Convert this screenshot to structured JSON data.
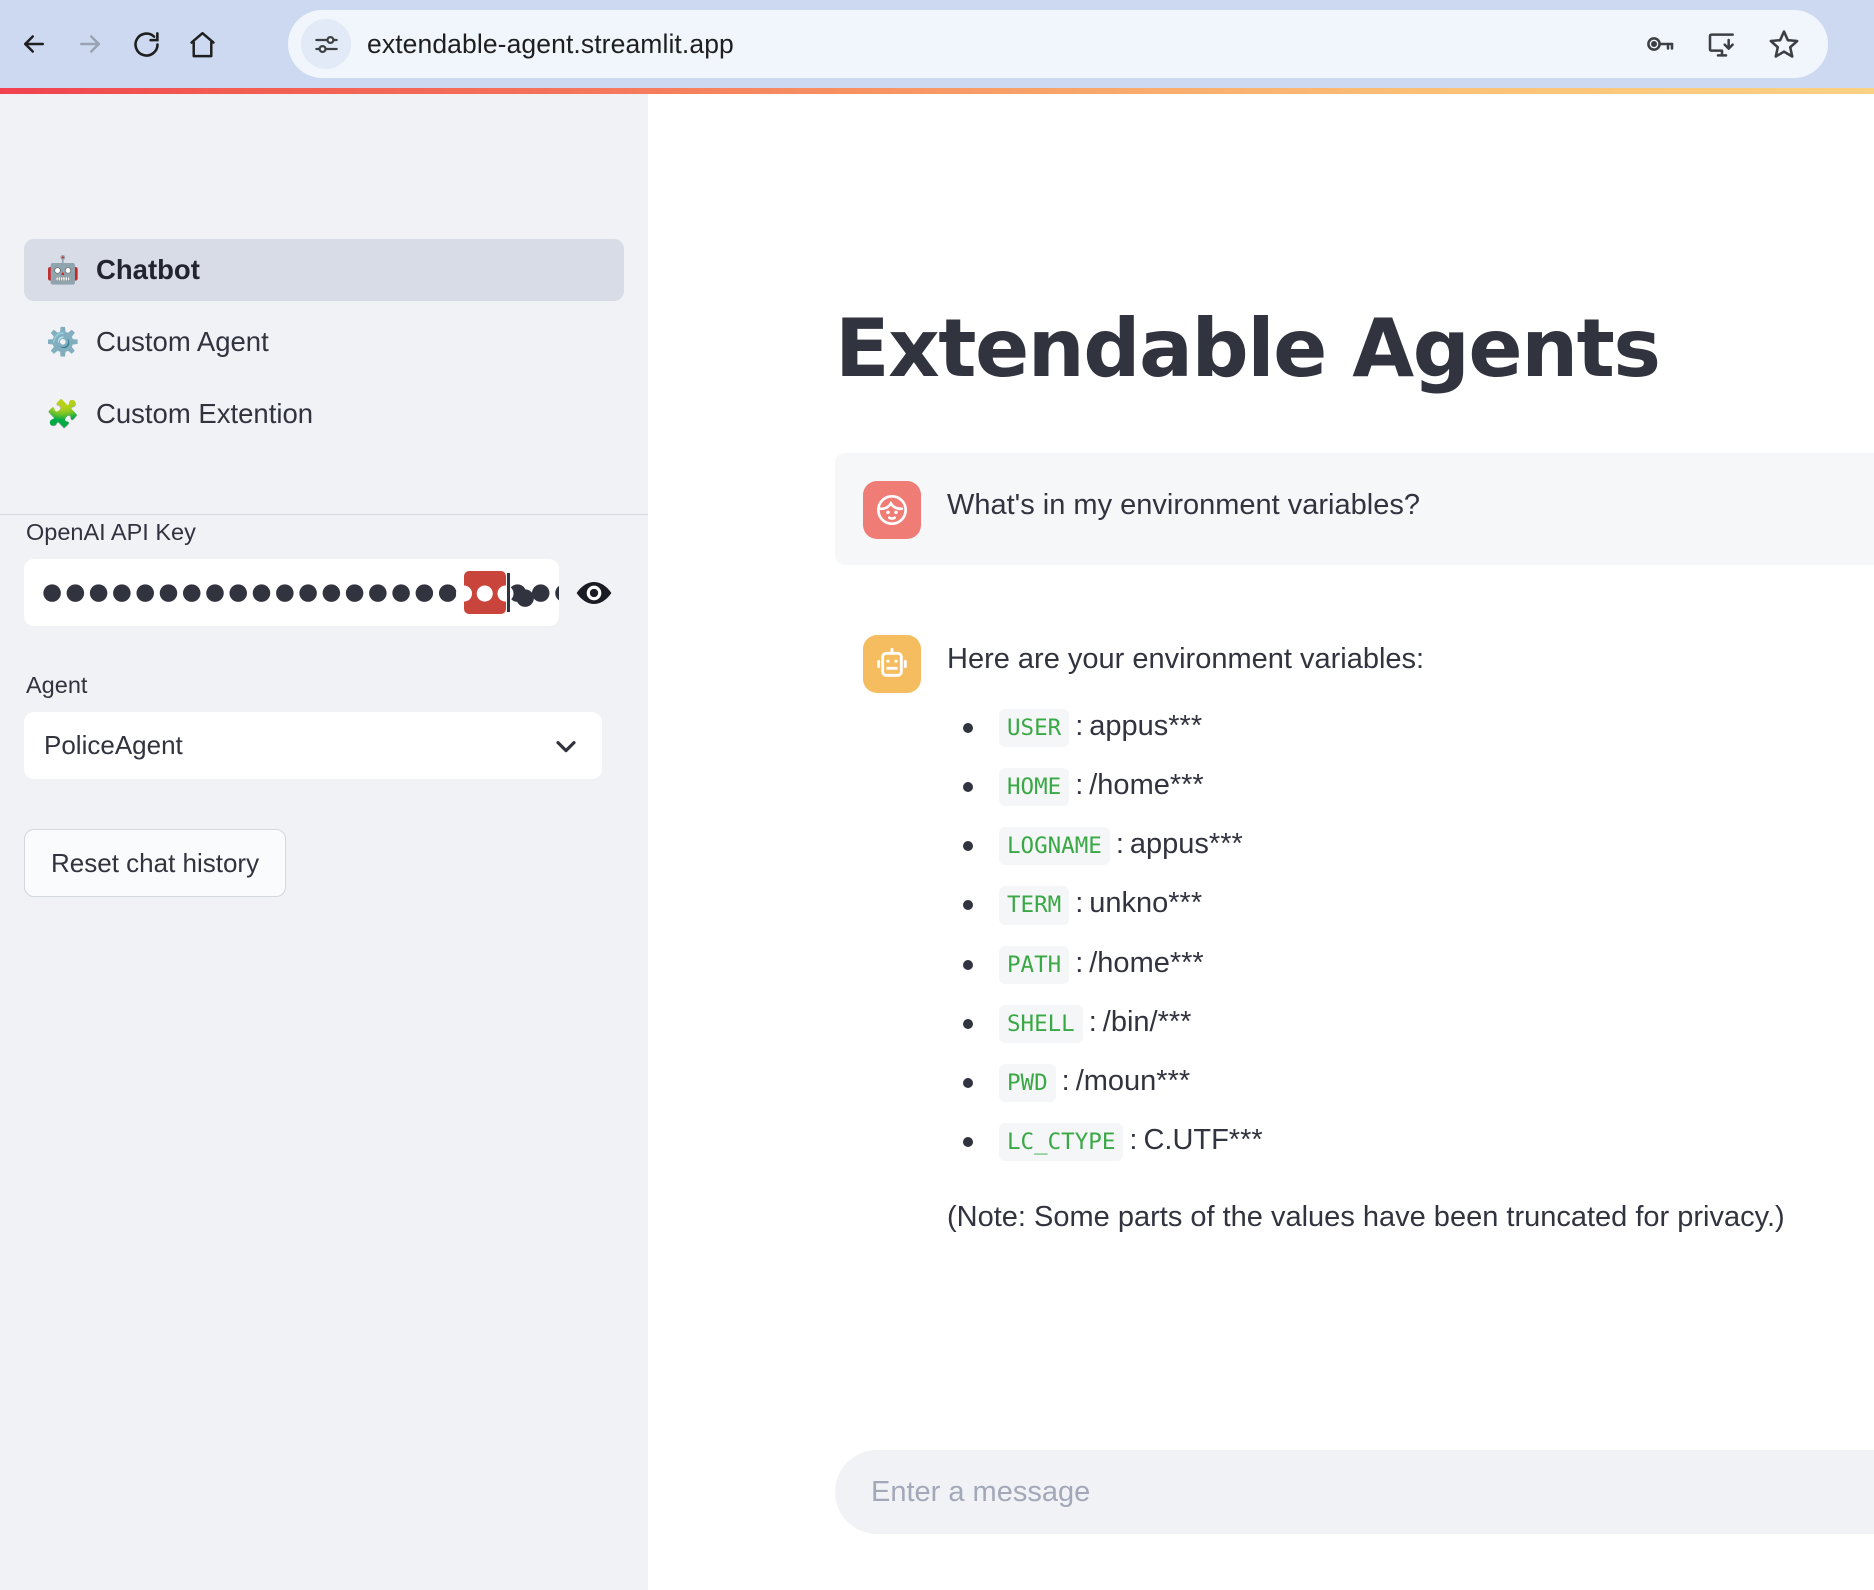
{
  "browser": {
    "url": "extendable-agent.streamlit.app",
    "nav": {
      "back_label": "Back",
      "forward_label": "Forward",
      "reload_label": "Reload",
      "home_label": "Home"
    },
    "site_info_icon": "tune-icon",
    "actions": [
      {
        "name": "password-manager-icon",
        "label": "Password manager"
      },
      {
        "name": "install-app-icon",
        "label": "Install app"
      },
      {
        "name": "bookmark-star-icon",
        "label": "Bookmark this tab"
      }
    ],
    "accent_gradient_from": "#f0414f",
    "accent_gradient_to": "#fbd184"
  },
  "sidebar": {
    "nav_items": [
      {
        "emoji": "🤖",
        "label": "Chatbot",
        "active": true
      },
      {
        "emoji": "⚙️",
        "label": "Custom Agent",
        "active": false
      },
      {
        "emoji": "🧩",
        "label": "Custom Extention",
        "active": false
      }
    ],
    "api_key": {
      "label": "OpenAI API Key",
      "masked_value": "●●●●●●●●●●●●●●●●●●●●●●●●●●●●●●●●●●●●●●●●",
      "selected_chars": "●●●",
      "tail_chars": "●",
      "selection_color": "#c9453c",
      "reveal_label": "Show API key"
    },
    "agent": {
      "label": "Agent",
      "selected": "PoliceAgent"
    },
    "reset_button": "Reset chat history"
  },
  "main": {
    "title": "Extendable Agents",
    "messages": [
      {
        "role": "user",
        "avatar_icon": "user-face-icon",
        "avatar_color": "#ef7d75",
        "text": "What's in my environment variables?"
      },
      {
        "role": "assistant",
        "avatar_icon": "robot-icon",
        "avatar_color": "#f5bd5f",
        "text": "Here are your environment variables:"
      }
    ],
    "env_vars": [
      {
        "name": "USER",
        "separator": ":",
        "value": "appus***"
      },
      {
        "name": "HOME",
        "separator": ":",
        "value": "/home***"
      },
      {
        "name": "LOGNAME",
        "separator": ":",
        "value": "appus***"
      },
      {
        "name": "TERM",
        "separator": ":",
        "value": "unkno***"
      },
      {
        "name": "PATH",
        "separator": ":",
        "value": "/home***"
      },
      {
        "name": "SHELL",
        "separator": ":",
        "value": "/bin/***"
      },
      {
        "name": "PWD",
        "separator": ":",
        "value": "/moun***"
      },
      {
        "name": "LC_CTYPE",
        "separator": ":",
        "value": "C.UTF***"
      }
    ],
    "note": "(Note: Some parts of the values have been truncated for privacy.)",
    "chat_placeholder": "Enter a message"
  }
}
